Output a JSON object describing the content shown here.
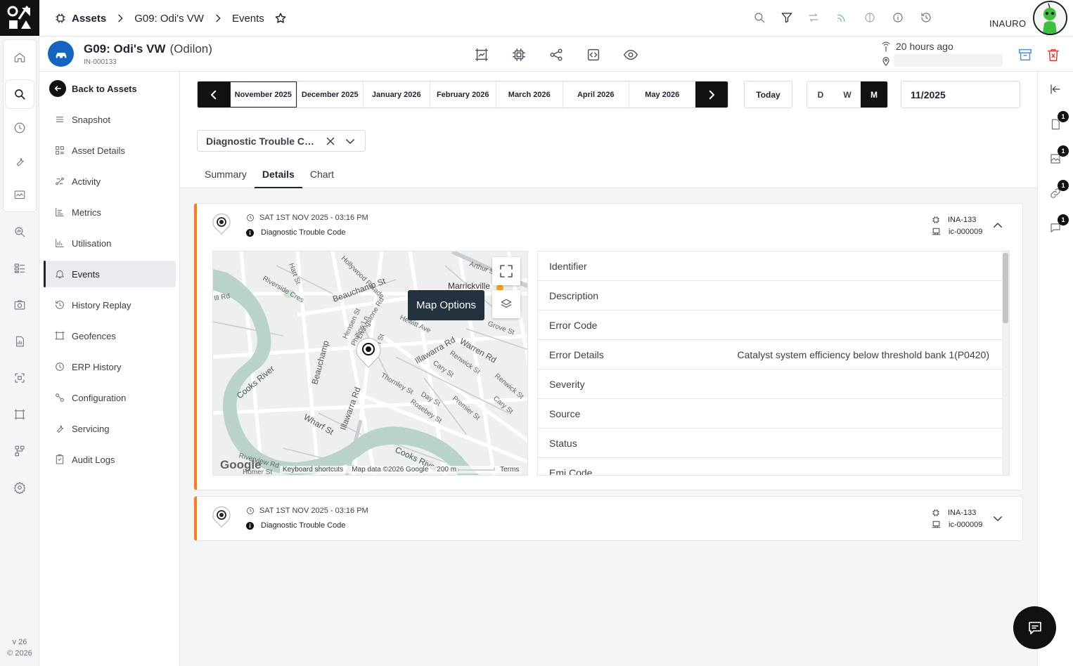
{
  "topbar": {
    "crumbs": [
      "Assets",
      "G09: Odi's VW",
      "Events"
    ],
    "brand": "INAURO"
  },
  "rail": {
    "version": "v 26",
    "copyright": "© 2026"
  },
  "asset": {
    "name": "G09: Odi's VW",
    "owner": "(Odilon)",
    "id": "IN-000133",
    "last_seen": "20 hours ago"
  },
  "sidebar": {
    "back_label": "Back to Assets",
    "items": [
      {
        "label": "Snapshot",
        "icon": "list-icon"
      },
      {
        "label": "Asset Details",
        "icon": "grid-icon"
      },
      {
        "label": "Activity",
        "icon": "activity-icon"
      },
      {
        "label": "Metrics",
        "icon": "metrics-icon"
      },
      {
        "label": "Utilisation",
        "icon": "bar-chart-icon"
      },
      {
        "label": "Events",
        "icon": "bell-icon"
      },
      {
        "label": "History Replay",
        "icon": "history-icon"
      },
      {
        "label": "Geofences",
        "icon": "geofence-icon"
      },
      {
        "label": "ERP History",
        "icon": "erp-icon"
      },
      {
        "label": "Configuration",
        "icon": "configuration-icon"
      },
      {
        "label": "Servicing",
        "icon": "wrench-icon"
      },
      {
        "label": "Audit Logs",
        "icon": "clipboard-icon"
      }
    ],
    "active_index": 5
  },
  "calendar": {
    "months": [
      "November 2025",
      "December 2025",
      "January 2026",
      "February 2026",
      "March 2026",
      "April 2026",
      "May 2026"
    ],
    "selected_month": "November 2025",
    "today_label": "Today",
    "views": [
      "D",
      "W",
      "M"
    ],
    "selected_view": "M",
    "date_value": "11/2025"
  },
  "filter": {
    "value": "Diagnostic Trouble Code"
  },
  "tabs": {
    "items": [
      "Summary",
      "Details",
      "Chart"
    ],
    "selected": "Details"
  },
  "events": [
    {
      "datetime": "SAT 1ST NOV 2025 - 03:16 PM",
      "type": "Diagnostic Trouble Code",
      "device": "INA-133",
      "connector": "ic-000009",
      "expanded": true
    },
    {
      "datetime": "SAT 1ST NOV 2025 - 03:16 PM",
      "type": "Diagnostic Trouble Code",
      "device": "INA-133",
      "connector": "ic-000009",
      "expanded": false
    }
  ],
  "map": {
    "tooltip": "Map Options",
    "google": "Google",
    "attribution": [
      "Keyboard shortcuts",
      "Map data ©2026 Google",
      "200 m",
      "Terms"
    ],
    "labels": [
      "Beauchamp St",
      "Cooks River",
      "Illawarra Rd",
      "Warren Rd",
      "Marrickville",
      "Wharf St",
      "Thornley St",
      "Premier St",
      "Renwick St",
      "Riverside Cres",
      "Day St",
      "Rosebey St",
      "Cary St",
      "Livingstone Rd",
      "Hensen St",
      "Phillips Ln",
      "Glen St",
      "Arthur St",
      "Hollywood Parade",
      "Grove St",
      "Hewitt Ave",
      "Riverview Rd",
      "Homer St",
      "Hart St",
      "Ill Rd"
    ]
  },
  "details": [
    {
      "label": "Identifier",
      "value": ""
    },
    {
      "label": "Description",
      "value": ""
    },
    {
      "label": "Error Code",
      "value": ""
    },
    {
      "label": "Error Details",
      "value": "Catalyst system efficiency below threshold bank 1(P0420)"
    },
    {
      "label": "Severity",
      "value": ""
    },
    {
      "label": "Source",
      "value": ""
    },
    {
      "label": "Status",
      "value": ""
    },
    {
      "label": "Emi Code",
      "value": ""
    }
  ],
  "right_rail": {
    "badges": [
      "1",
      "1",
      "1",
      "1"
    ]
  },
  "colors": {
    "accent": "#ff7a1a",
    "dark": "#111111",
    "brand_blue": "#1565c0",
    "tooltip": "#243240"
  }
}
